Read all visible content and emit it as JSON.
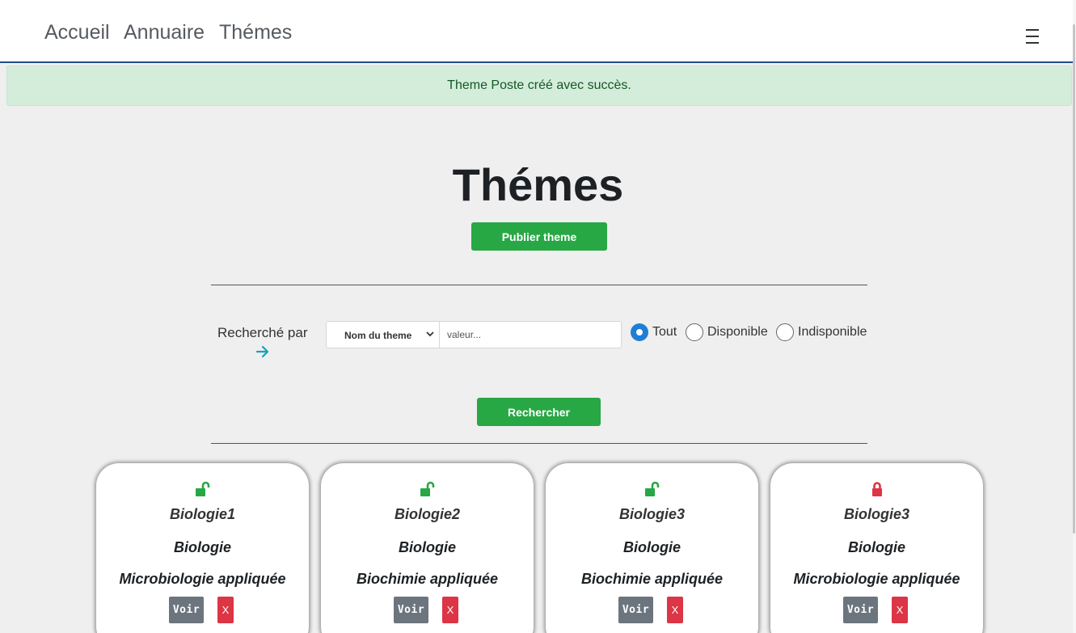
{
  "nav": {
    "links": [
      "Accueil",
      "Annuaire",
      "Thémes"
    ],
    "menu_icon": "hamburger-menu-icon"
  },
  "alert": {
    "message": "Theme Poste créé avec succès."
  },
  "page": {
    "title": "Thémes",
    "publish_label": "Publier theme"
  },
  "search": {
    "label": "Recherché par",
    "select_value": "Nom du theme",
    "input_placeholder": "valeur...",
    "radios": [
      {
        "label": "Tout",
        "checked": true
      },
      {
        "label": "Disponible",
        "checked": false
      },
      {
        "label": "Indisponible",
        "checked": false
      }
    ],
    "submit_label": "Rechercher"
  },
  "colors": {
    "accent_green": "#28a745",
    "danger_red": "#dc3545",
    "radio_blue": "#1e7ed6",
    "arrow_teal": "#17a2b8"
  },
  "cards": [
    {
      "lock": "unlocked",
      "name": "Biologie1",
      "category": "Biologie",
      "subcategory": "Microbiologie appliquée",
      "view_label": "Voir",
      "delete_label": "X"
    },
    {
      "lock": "unlocked",
      "name": "Biologie2",
      "category": "Biologie",
      "subcategory": "Biochimie appliquée",
      "view_label": "Voir",
      "delete_label": "X"
    },
    {
      "lock": "unlocked",
      "name": "Biologie3",
      "category": "Biologie",
      "subcategory": "Biochimie appliquée",
      "view_label": "Voir",
      "delete_label": "X"
    },
    {
      "lock": "locked",
      "name": "Biologie3",
      "category": "Biologie",
      "subcategory": "Microbiologie appliquée",
      "view_label": "Voir",
      "delete_label": "X"
    }
  ]
}
